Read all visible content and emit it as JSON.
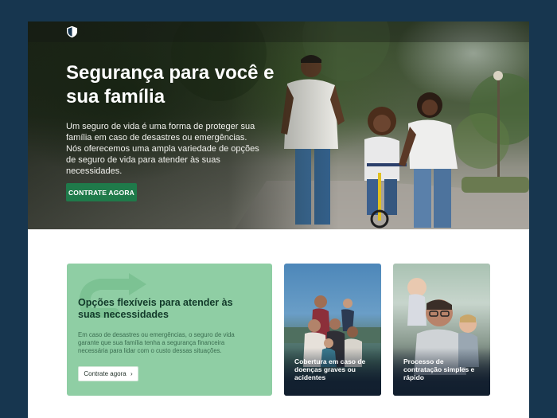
{
  "hero": {
    "title": "Segurança para você e sua família",
    "description": "Um seguro de vida é uma forma de proteger sua família em caso de desastres ou emergências. Nós oferecemos uma ampla variedade de opções de seguro de vida para atender às suas necessidades.",
    "cta_label": "CONTRATE AGORA"
  },
  "feature_card": {
    "title": "Opções flexíveis para atender às suas necessidades",
    "text": "Em caso de desastres ou emergências, o seguro de vida garante que sua família tenha a segurança financeira necessária para lidar com o custo dessas situações.",
    "button_label": "Contrate agora",
    "button_icon": "chevron-right-icon"
  },
  "image_cards": [
    {
      "label": "Cobertura em caso de doenças graves ou acidentes"
    },
    {
      "label": "Processo de contratação simples e rápido"
    }
  ],
  "colors": {
    "page_background": "#17364f",
    "primary_green": "#1f7a4a",
    "card_green": "#8fcea4",
    "card_title": "#123a2a"
  },
  "icons": {
    "logo": "shield-logo-icon"
  }
}
